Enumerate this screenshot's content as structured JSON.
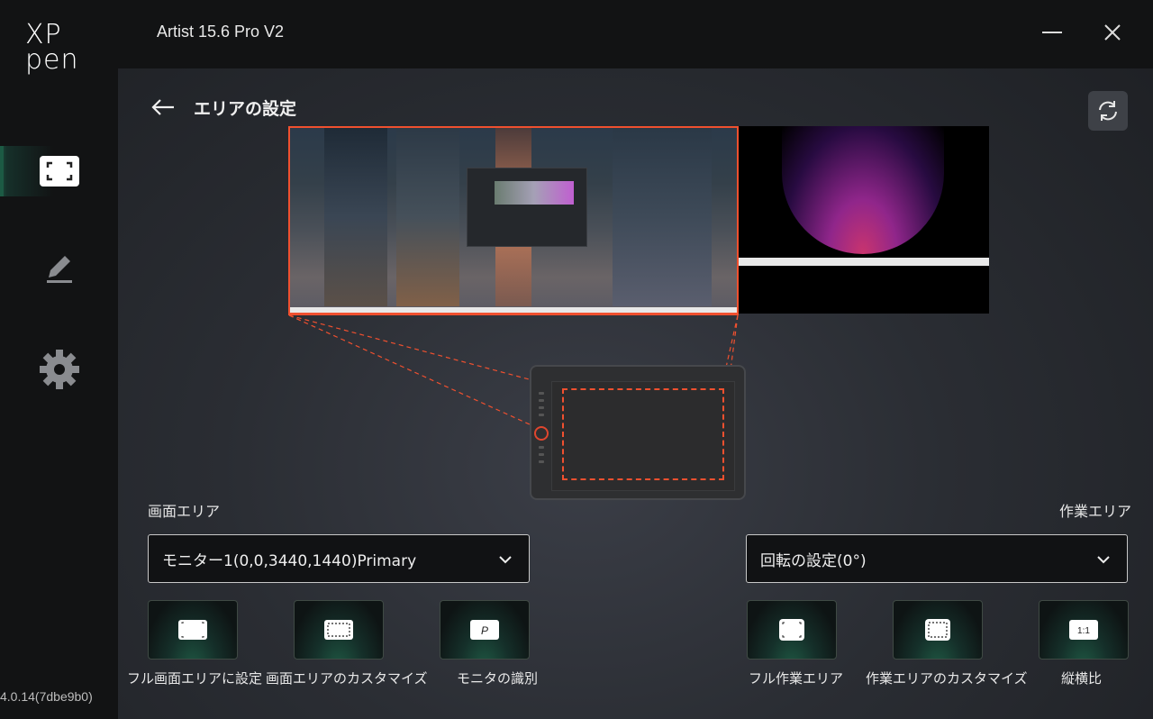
{
  "app": {
    "brand": "XP pen",
    "brand_line1": "XP",
    "brand_line2": "pen",
    "title": "Artist 15.6 Pro V2",
    "version": "4.0.14(7dbe9b0)"
  },
  "sidebar": {
    "items": [
      {
        "icon": "display-area-icon",
        "active": true
      },
      {
        "icon": "pen-icon",
        "active": false
      },
      {
        "icon": "gear-icon",
        "active": false
      }
    ]
  },
  "page": {
    "title": "エリアの設定"
  },
  "screen_area": {
    "label": "画面エリア",
    "selected_monitor": "モニター1(0,0,3440,1440)Primary",
    "options": [
      {
        "label": "フル画面エリアに設定",
        "icon": "full-screen-icon"
      },
      {
        "label": "画面エリアのカスタマイズ",
        "icon": "custom-area-icon"
      },
      {
        "label": "モニタの識別",
        "icon": "identify-monitor-icon",
        "icon_text": "P"
      }
    ]
  },
  "work_area": {
    "label": "作業エリア",
    "rotation": "回転の設定(0°)",
    "options": [
      {
        "label": "フル作業エリア",
        "icon": "full-work-area-icon"
      },
      {
        "label": "作業エリアのカスタマイズ",
        "icon": "custom-work-area-icon"
      },
      {
        "label": "縦横比",
        "icon": "aspect-ratio-icon",
        "icon_text": "1:1"
      }
    ]
  },
  "colors": {
    "accent": "#f0502f",
    "active_nav": "#1c5a44",
    "background": "#121314"
  }
}
